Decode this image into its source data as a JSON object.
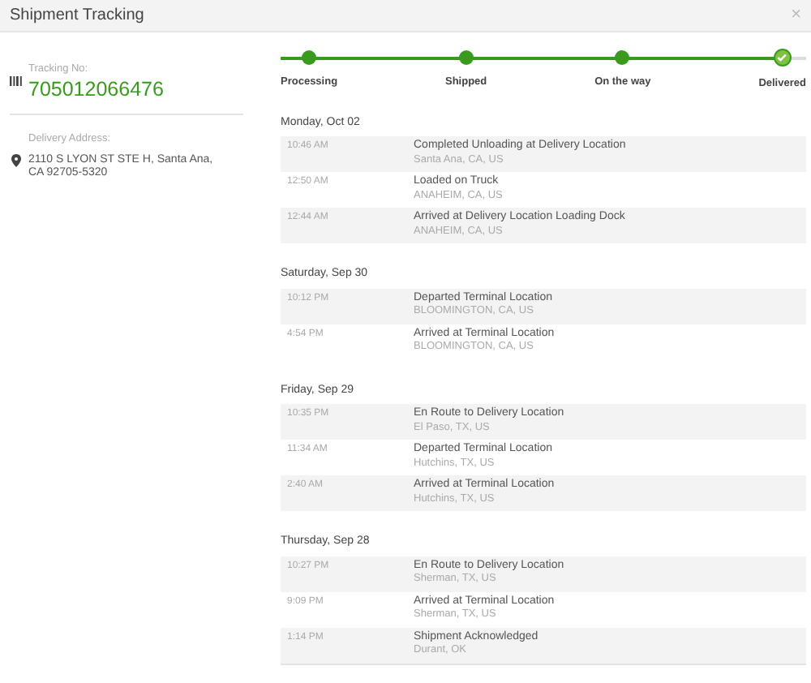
{
  "window": {
    "title": "Shipment Tracking",
    "close": "×"
  },
  "tracking": {
    "label": "Tracking No:",
    "number": "705012066476"
  },
  "address": {
    "label": "Delivery Address:",
    "text": "2110 S LYON ST STE H, Santa Ana, CA 92705-5320"
  },
  "steps": [
    {
      "label": "Processing",
      "completed": true,
      "current": false
    },
    {
      "label": "Shipped",
      "completed": true,
      "current": false
    },
    {
      "label": "On the way",
      "completed": true,
      "current": false
    },
    {
      "label": "Delivered",
      "completed": true,
      "current": true
    }
  ],
  "days": [
    {
      "date": "Monday, Oct 02",
      "events": [
        {
          "time": "10:46 AM",
          "status": "Completed Unloading at Delivery Location",
          "location": "Santa Ana, CA, US"
        },
        {
          "time": "12:50 AM",
          "status": "Loaded on Truck",
          "location": "ANAHEIM, CA, US"
        },
        {
          "time": "12:44 AM",
          "status": "Arrived at Delivery Location Loading Dock",
          "location": "ANAHEIM, CA, US"
        }
      ]
    },
    {
      "date": "Saturday, Sep 30",
      "events": [
        {
          "time": "10:12 PM",
          "status": "Departed Terminal Location",
          "location": "BLOOMINGTON, CA, US"
        },
        {
          "time": "4:54 PM",
          "status": "Arrived at Terminal Location",
          "location": "BLOOMINGTON, CA, US"
        }
      ]
    },
    {
      "date": "Friday, Sep 29",
      "events": [
        {
          "time": "10:35 PM",
          "status": "En Route to Delivery Location",
          "location": "El Paso, TX, US"
        },
        {
          "time": "11:34 AM",
          "status": "Departed Terminal Location",
          "location": "Hutchins, TX, US"
        },
        {
          "time": "2:40 AM",
          "status": "Arrived at Terminal Location",
          "location": "Hutchins, TX, US"
        }
      ]
    },
    {
      "date": "Thursday, Sep 28",
      "events": [
        {
          "time": "10:27 PM",
          "status": "En Route to Delivery Location",
          "location": "Sherman, TX, US"
        },
        {
          "time": "9:09 PM",
          "status": "Arrived at Terminal Location",
          "location": "Sherman, TX, US"
        },
        {
          "time": "1:14 PM",
          "status": "Shipment Acknowledged",
          "location": "Durant, OK"
        }
      ]
    }
  ]
}
